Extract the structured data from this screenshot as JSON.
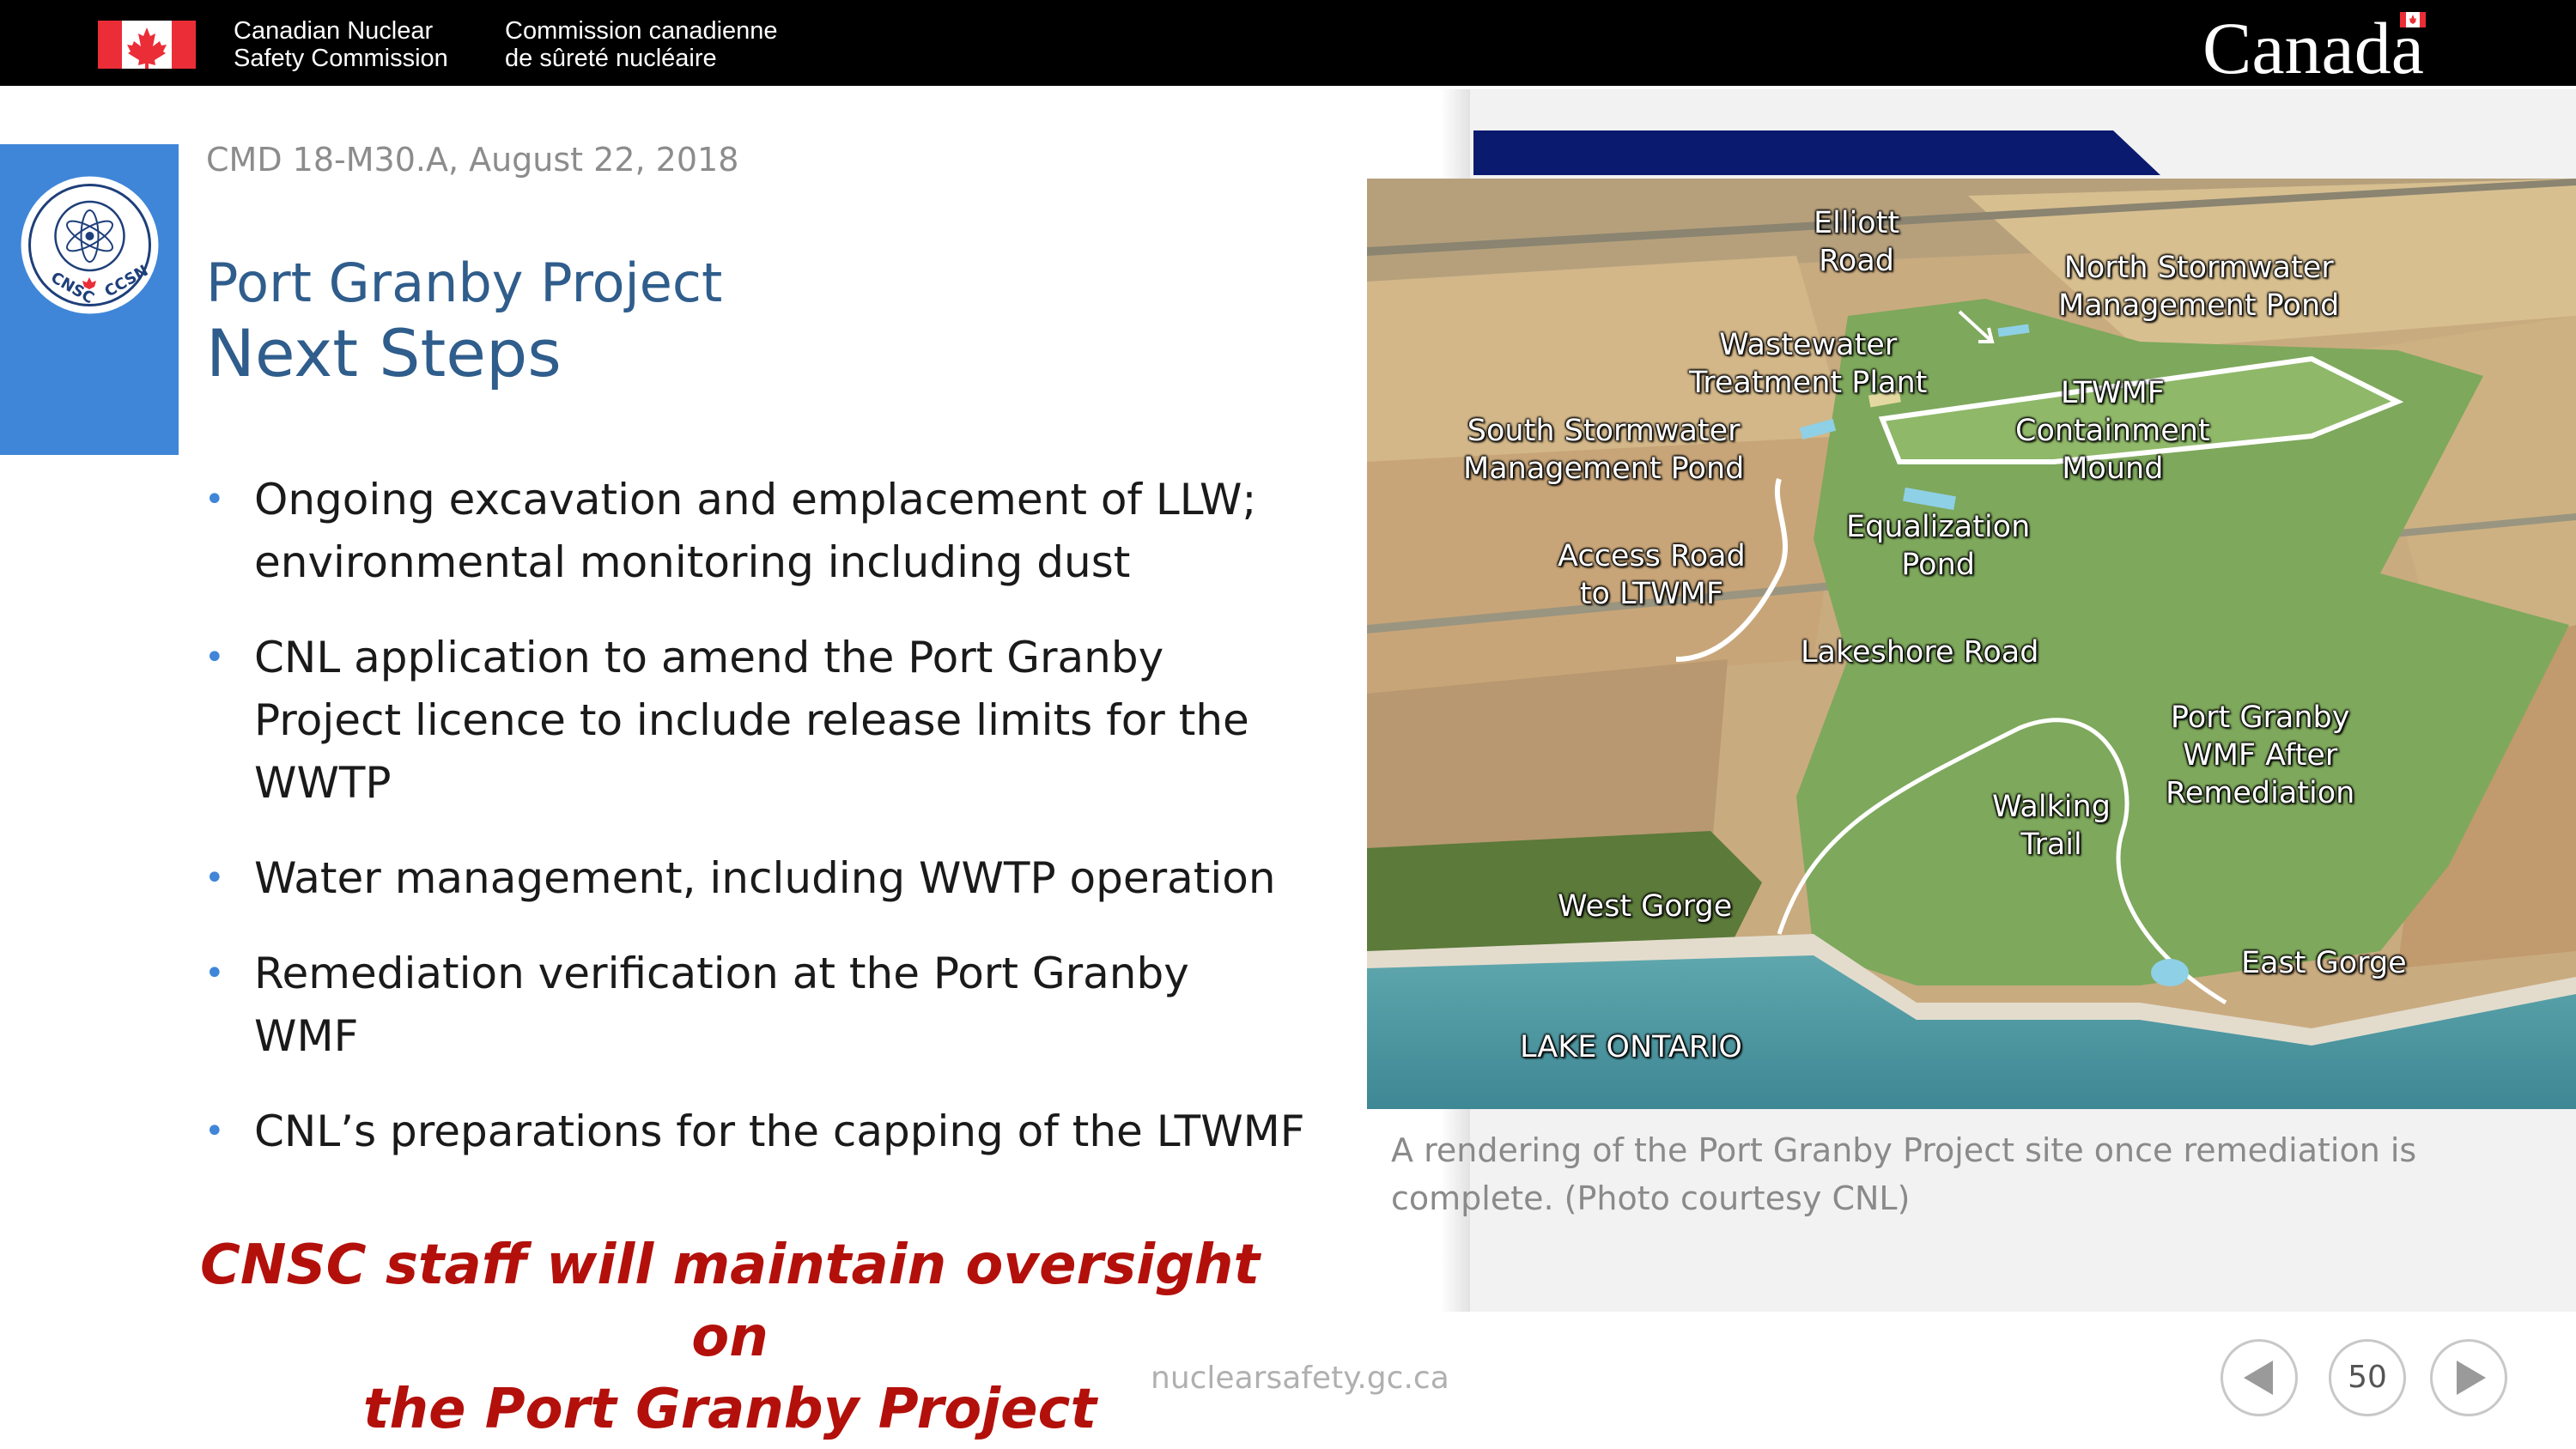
{
  "header": {
    "org_name_en_line1": "Canadian Nuclear",
    "org_name_en_line2": "Safety Commission",
    "org_name_fr_line1": "Commission canadienne",
    "org_name_fr_line2": "de sûreté nucléaire",
    "wordmark": "Canada"
  },
  "seal": {
    "text_left": "CNSC",
    "text_right": "CCSN"
  },
  "slide": {
    "reference": "CMD 18-M30.A, August 22, 2018",
    "title_line1": "Port Granby Project",
    "title_line2": "Next Steps",
    "bullets": [
      {
        "line1": "Ongoing excavation and emplacement of LLW;",
        "line2": "environmental monitoring including dust",
        "line3": ""
      },
      {
        "line1": "CNL application to amend the Port Granby",
        "line2": "Project licence to include release limits for the",
        "line3": "WWTP"
      },
      {
        "line1": "Water management, including WWTP operation",
        "line2": "",
        "line3": ""
      },
      {
        "line1": "Remediation verification at the Port Granby",
        "line2": "WMF",
        "line3": ""
      },
      {
        "line1": "CNL’s preparations for the capping of the LTWMF",
        "line2": "",
        "line3": ""
      }
    ],
    "conclusion_line1": "CNSC staff will maintain oversight on",
    "conclusion_line2": "the Port Granby Project",
    "footer_url": "nuclearsafety.gc.ca"
  },
  "map": {
    "labels": {
      "elliott_1": "Elliott",
      "elliott_2": "Road",
      "north_pond_1": "North Stormwater",
      "north_pond_2": "Management Pond",
      "wwtp_1": "Wastewater",
      "wwtp_2": "Treatment Plant",
      "ltwmf_1": "LTWMF",
      "ltwmf_2": "Containment",
      "ltwmf_3": "Mound",
      "south_pond_1": "South Stormwater",
      "south_pond_2": "Management Pond",
      "equal_1": "Equalization",
      "equal_2": "Pond",
      "access_1": "Access Road",
      "access_2": "to LTWMF",
      "lakeshore": "Lakeshore Road",
      "wmf_1": "Port Granby",
      "wmf_2": "WMF After",
      "wmf_3": "Remediation",
      "walking_1": "Walking",
      "walking_2": "Trail",
      "west_gorge": "West Gorge",
      "east_gorge": "East Gorge",
      "lake": "LAKE ONTARIO"
    },
    "caption_line1": "A rendering of the Port Granby Project site once remediation is",
    "caption_line2": "complete. (Photo courtesy CNL)"
  },
  "navigation": {
    "page_number": "50"
  },
  "colors": {
    "header_bg": "#000000",
    "flag_red": "#eb2d37",
    "accent_blue": "#3f86d8",
    "title_blue": "#2f5d8c",
    "conclusion_red": "#b3100b",
    "navy": "#0a1a6e"
  }
}
